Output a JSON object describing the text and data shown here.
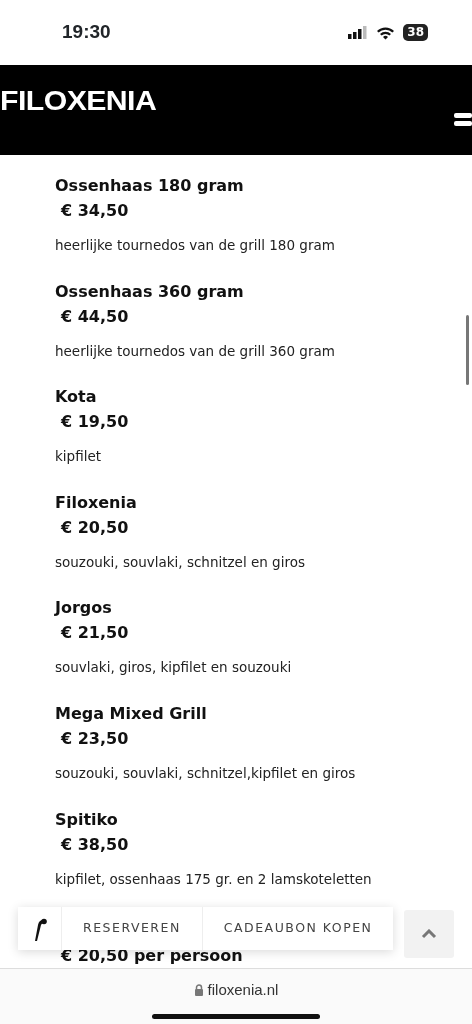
{
  "status_bar": {
    "time": "19:30",
    "battery": "38"
  },
  "header": {
    "logo": "FILOXENIA"
  },
  "menu_items": [
    {
      "name": "Ossenhaas 180 gram",
      "price": "€ 34,50",
      "description": "heerlijke tournedos van de grill 180 gram"
    },
    {
      "name": "Ossenhaas 360 gram",
      "price": "€ 44,50",
      "description": "heerlijke tournedos van de grill 360 gram"
    },
    {
      "name": "Kota",
      "price": "€ 19,50",
      "description": "kipfilet"
    },
    {
      "name": "Filoxenia",
      "price": "€ 20,50",
      "description": "souzouki, souvlaki, schnitzel en giros"
    },
    {
      "name": "Jorgos",
      "price": "€ 21,50",
      "description": "souvlaki, giros, kipfilet en souzouki"
    },
    {
      "name": "Mega Mixed Grill",
      "price": "€ 23,50",
      "description": "souzouki, souvlaki, schnitzel,kipfilet en giros"
    },
    {
      "name": "Spitiko",
      "price": "€ 38,50",
      "description": "kipfilet, ossenhaas 175 gr. en 2 lamskoteletten"
    }
  ],
  "partial_price": "€ 20,50 per persoon",
  "floating_bar": {
    "buttons": [
      "RESERVEREN",
      "CADEAUBON KOPEN"
    ]
  },
  "address_bar": {
    "url": "filoxenia.nl"
  }
}
